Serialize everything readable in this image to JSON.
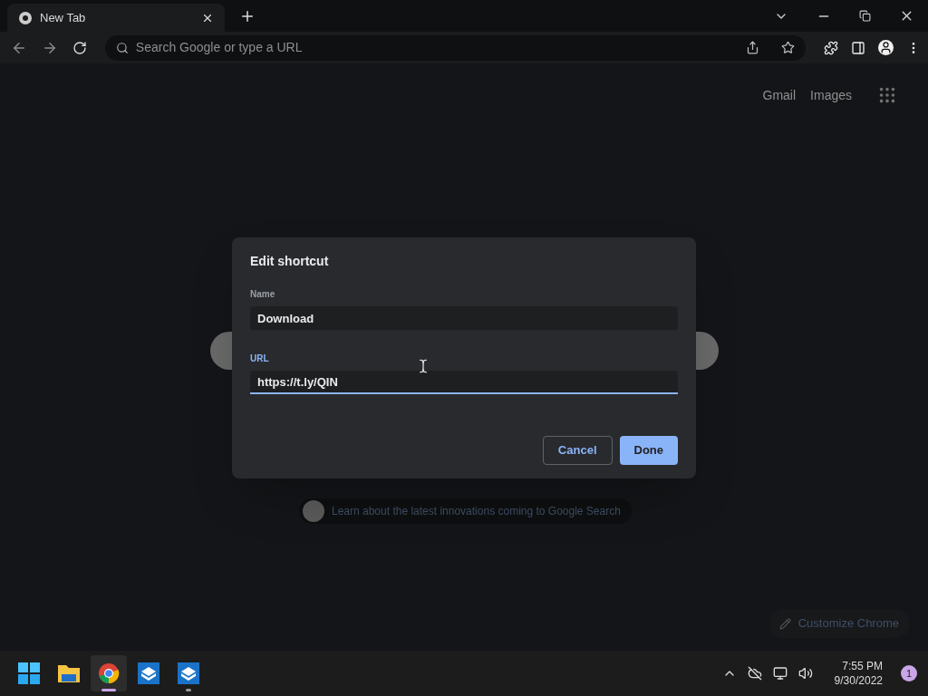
{
  "tab": {
    "title": "New Tab",
    "selected": true
  },
  "omnibox": {
    "placeholder": "Search Google or type a URL"
  },
  "top_links": [
    "Gmail",
    "Images"
  ],
  "promo": "Learn about the latest innovations coming to Google Search",
  "customize": "Customize Chrome",
  "dialog": {
    "title": "Edit shortcut",
    "fields": [
      {
        "label": "Name",
        "value": "Download",
        "focused": false
      },
      {
        "label": "URL",
        "value": "https://t.ly/QIN",
        "focused": true
      }
    ],
    "buttons": [
      {
        "label": "Cancel",
        "kind": "secondary"
      },
      {
        "label": "Done",
        "kind": "primary"
      }
    ]
  },
  "taskbar": {
    "apps": [
      {
        "kind": "start",
        "active": false,
        "running": false
      },
      {
        "kind": "folder",
        "active": false,
        "running": false
      },
      {
        "kind": "chrome",
        "active": true,
        "running": true
      },
      {
        "kind": "box",
        "active": false,
        "running": false
      },
      {
        "kind": "box",
        "active": false,
        "running": true
      }
    ],
    "time": "7:55 PM",
    "date": "9/30/2022",
    "notifications": "1"
  }
}
